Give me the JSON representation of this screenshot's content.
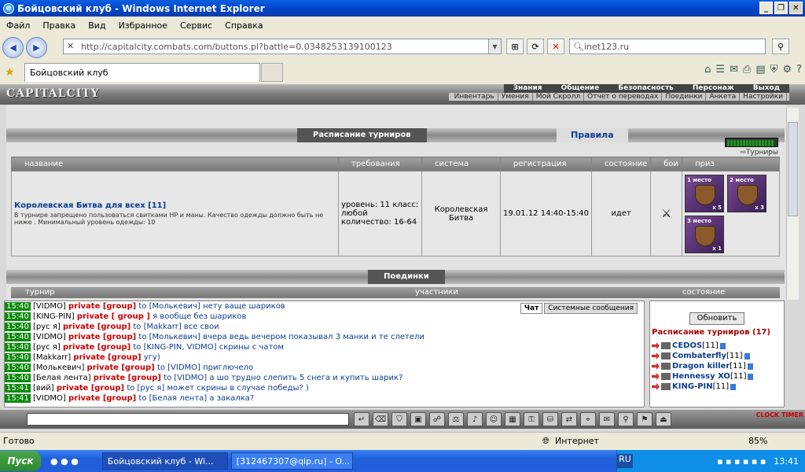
{
  "window": {
    "title": "Бойцовский клуб - Windows Internet Explorer"
  },
  "menu": [
    "Файл",
    "Правка",
    "Вид",
    "Избранное",
    "Сервис",
    "Справка"
  ],
  "address": {
    "url": "http://capitalcity.combats.com/buttons.pl?battle=0.0348253139100123"
  },
  "search": {
    "value": "inet123.ru"
  },
  "tab": {
    "label": "Бойцовский клуб"
  },
  "game": {
    "logo": "CAPITALCITY",
    "topnav": [
      "Знания",
      "Общение",
      "Безопасность",
      "Персонаж",
      "Выход"
    ],
    "subnav": [
      "Инвентарь",
      "Умения",
      "Мой Скролл",
      "Отчет о переводах",
      "Поединки",
      "Анкета",
      "Настройки"
    ],
    "banner_title": "Расписание турниров",
    "rules": "Правила",
    "tournaments_link": "Турниры",
    "table": {
      "headers": [
        "название",
        "требования",
        "система",
        "регистрация",
        "состояние",
        "бои",
        "приз"
      ],
      "row": {
        "name": "Королевская Битва для всех [11]",
        "desc": "В турнире запрещено пользоваться свитками HP и маны. Качество одежды должно быть не ниже . Минимальный уровень одежды: 10",
        "req": "уровень: 11 класс: любой количество: 16-64",
        "system": "Королевская Битва",
        "reg": "19.01.12 14:40-15:40",
        "state": "идет",
        "prizes": [
          {
            "place": "1 место",
            "qty": "x 5"
          },
          {
            "place": "2 место",
            "qty": "x 3"
          },
          {
            "place": "3 место",
            "qty": "x 1"
          }
        ]
      }
    },
    "banner2_title": "Поединки",
    "hdr2": [
      "турнир",
      "участники",
      "состояние"
    ]
  },
  "chat": {
    "tabs": [
      "Чат",
      "Системные сообщения"
    ],
    "lines": [
      {
        "time": "15:40",
        "nick": "[VIDMO]",
        "priv": "private [group]",
        "to": "to [Молькевич]",
        "msg": "нету ваще шариков"
      },
      {
        "time": "15:40",
        "nick": "[KING-PIN]",
        "priv": "private [ group ]",
        "to": "",
        "msg": "я вообще без шариков"
      },
      {
        "time": "15:40",
        "nick": "[рус я]",
        "priv": "private [group]",
        "to": "to [Makkarr]",
        "msg": "все свои"
      },
      {
        "time": "15:40",
        "nick": "[VIDMO]",
        "priv": "private [group]",
        "to": "to [Молькевич]",
        "msg": "вчера ведь вечером показывал 3 манки и те слетели"
      },
      {
        "time": "15:40",
        "nick": "[рус я]",
        "priv": "private [group]",
        "to": "to [KING-PIN, VIDMO]",
        "msg": "скрины с чатом"
      },
      {
        "time": "15:40",
        "nick": "[Makkarr]",
        "priv": "private [group]",
        "to": "",
        "msg": "угу)"
      },
      {
        "time": "15:40",
        "nick": "[Молькевич]",
        "priv": "private [group]",
        "to": "to [VIDMO]",
        "msg": "приглючело"
      },
      {
        "time": "15:40",
        "nick": "[Белая лента]",
        "priv": "private [group]",
        "to": "to [VIDMO]",
        "msg": "а шо трудно слепить 5 снега и купить шарик?"
      },
      {
        "time": "15:41",
        "nick": "[вий]",
        "priv": "private [group]",
        "to": "to [рус я]",
        "msg": "может скрины в случае победы? )"
      },
      {
        "time": "15:41",
        "nick": "[VIDMO]",
        "priv": "private [group]",
        "to": "to [Белая лента]",
        "msg": "а закалка?"
      }
    ]
  },
  "side": {
    "refresh": "Обновить",
    "title": "Расписание турниров (17)",
    "players": [
      {
        "name": "CEDOS",
        "lvl": "[11]"
      },
      {
        "name": "Combaterfly",
        "lvl": "[11]"
      },
      {
        "name": "Dragon killer",
        "lvl": "[11]"
      },
      {
        "name": "Hennessy XO",
        "lvl": "[11]"
      },
      {
        "name": "KING-PIN",
        "lvl": "[11]"
      }
    ]
  },
  "status": {
    "left": "Готово",
    "zone": "Интернет",
    "zoom": "85%"
  },
  "taskbar": {
    "start": "Пуск",
    "tasks": [
      "Бойцовский клуб - Wi...",
      "[312467307@qip.ru] - O..."
    ],
    "lang": "RU",
    "time": "13:41"
  },
  "clock": "CLOCK TIMER"
}
